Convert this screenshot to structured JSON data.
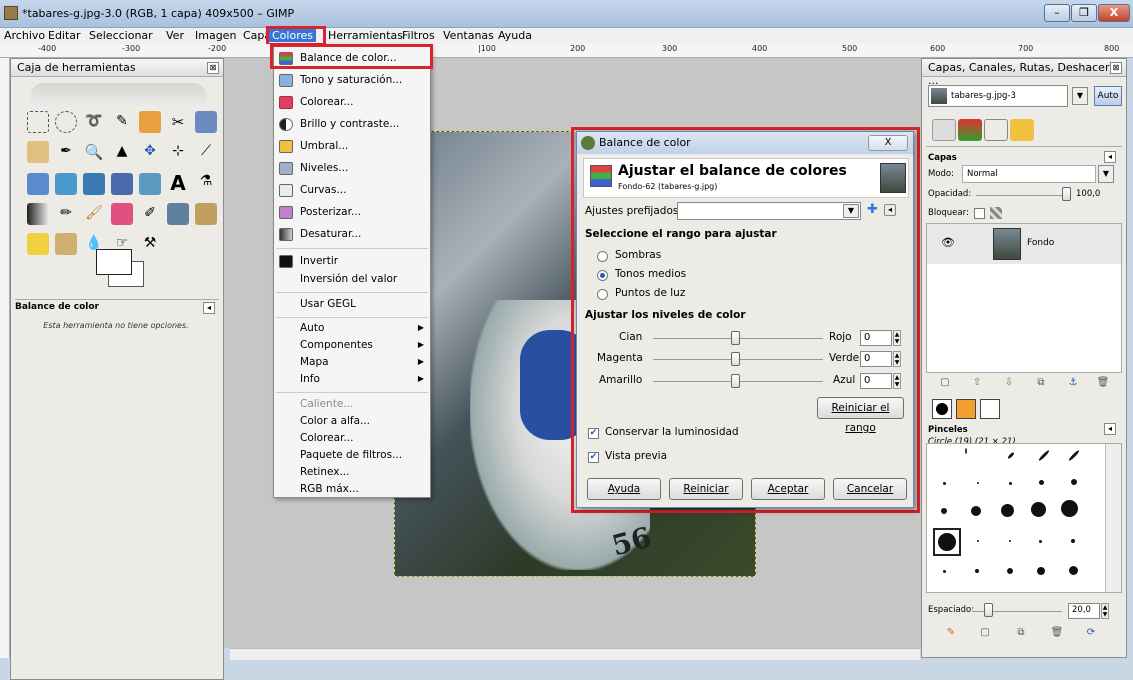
{
  "window": {
    "title": "*tabares-g.jpg-3.0 (RGB, 1 capa) 409x500 – GIMP",
    "min": "–",
    "max": "❐",
    "close": "X"
  },
  "menubar": [
    "Archivo",
    "Editar",
    "Seleccionar",
    "Ver",
    "Imagen",
    "Capa",
    "Colores",
    "Herramientas",
    "Filtros",
    "Ventanas",
    "Ayuda"
  ],
  "ruler": [
    "-400",
    "-300",
    "-200",
    "|100",
    "200",
    "300",
    "400",
    "500",
    "600",
    "700",
    "800"
  ],
  "toolbox": {
    "title": "Caja de herramientas",
    "options_title": "Balance de color",
    "options_msg": "Esta herramienta no tiene opciones."
  },
  "colores_menu": [
    {
      "label": "Balance de color...",
      "icon": "color-balance-icon",
      "highlight": true
    },
    {
      "label": "Tono y saturación...",
      "icon": "hue-saturation-icon"
    },
    {
      "label": "Colorear...",
      "icon": "colorize-icon"
    },
    {
      "label": "Brillo y contraste...",
      "icon": "brightness-contrast-icon"
    },
    {
      "label": "Umbral...",
      "icon": "threshold-icon"
    },
    {
      "label": "Niveles...",
      "icon": "levels-icon"
    },
    {
      "label": "Curvas...",
      "icon": "curves-icon"
    },
    {
      "label": "Posterizar...",
      "icon": "posterize-icon"
    },
    {
      "label": "Desaturar...",
      "icon": "desaturate-icon"
    },
    {
      "label": "Invertir",
      "icon": "invert-icon"
    },
    {
      "label": "Inversión del valor"
    },
    {
      "label": "Usar GEGL"
    },
    {
      "label": "Auto",
      "submenu": true
    },
    {
      "label": "Componentes",
      "submenu": true
    },
    {
      "label": "Mapa",
      "submenu": true
    },
    {
      "label": "Info",
      "submenu": true
    },
    {
      "label": "Caliente...",
      "disabled": true
    },
    {
      "label": "Color a alfa..."
    },
    {
      "label": "Colorear..."
    },
    {
      "label": "Paquete de filtros..."
    },
    {
      "label": "Retinex..."
    },
    {
      "label": "RGB máx..."
    }
  ],
  "dialog": {
    "title": "Balance de color",
    "close": "X",
    "heading": "Ajustar el balance de colores",
    "subheading": "Fondo-62 (tabares-g.jpg)",
    "presets_label": "Ajustes prefijados:",
    "range_label": "Seleccione el rango para ajustar",
    "ranges": [
      {
        "label": "Sombras",
        "checked": false
      },
      {
        "label": "Tonos medios",
        "checked": true
      },
      {
        "label": "Puntos de luz",
        "checked": false
      }
    ],
    "levels_label": "Ajustar los niveles de color",
    "sliders": [
      {
        "left": "Cian",
        "right": "Rojo",
        "value": "0"
      },
      {
        "left": "Magenta",
        "right": "Verde",
        "value": "0"
      },
      {
        "left": "Amarillo",
        "right": "Azul",
        "value": "0"
      }
    ],
    "reset_range": "Reiniciar el rango",
    "preserve_luminosity": "Conservar la luminosidad",
    "preview": "Vista previa",
    "buttons": [
      "Ayuda",
      "Reiniciar",
      "Aceptar",
      "Cancelar"
    ]
  },
  "dock": {
    "title": "Capas, Canales, Rutas, Deshacer - ...",
    "image_combo": "tabares-g.jpg-3",
    "auto": "Auto",
    "layers_title": "Capas",
    "mode_label": "Modo:",
    "mode_value": "Normal",
    "opacity_label": "Opacidad:",
    "opacity_value": "100,0",
    "lock_label": "Bloquear:",
    "layer_name": "Fondo",
    "brushes_title": "Pinceles",
    "brush_name": "Circle (19) (21 × 21)",
    "spacing_label": "Espaciado:",
    "spacing_value": "20,0"
  },
  "image": {
    "jersey_number": "56"
  }
}
